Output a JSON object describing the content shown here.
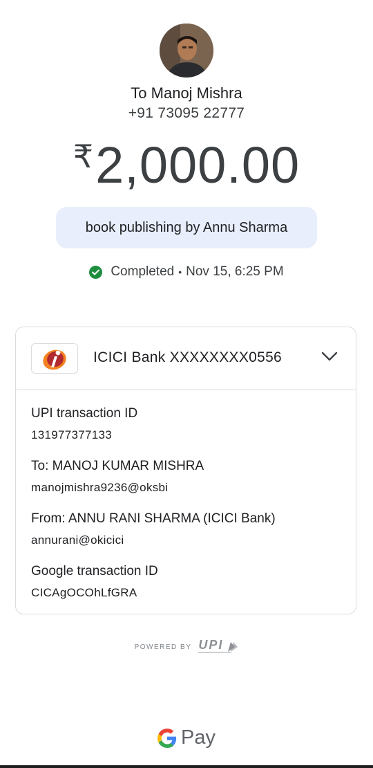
{
  "recipient": {
    "name": "To Manoj Mishra",
    "phone": "+91 73095 22777"
  },
  "payment": {
    "currency_symbol": "₹",
    "amount": "2,000.00",
    "note": "book publishing by Annu Sharma",
    "status": "Completed",
    "separator": "•",
    "datetime": "Nov 15, 6:25 PM",
    "status_color": "#1e8e3e"
  },
  "account": {
    "bank_label": "ICICI Bank XXXXXXXX0556",
    "logo_icon": "icici-logo-icon",
    "expand_icon": "chevron-down-icon"
  },
  "details": {
    "upi_label": "UPI transaction ID",
    "upi_value": "131977377133",
    "to_label": "To: MANOJ KUMAR  MISHRA",
    "to_value": "manojmishra9236@oksbi",
    "from_label": "From: ANNU RANI SHARMA (ICICI Bank)",
    "from_value": "annurani@okicici",
    "google_label": "Google transaction ID",
    "google_value": "CICAgOCOhLfGRA"
  },
  "footer": {
    "powered_by": "POWERED BY",
    "upi_logo": "UPI",
    "brand_pay": "Pay"
  }
}
